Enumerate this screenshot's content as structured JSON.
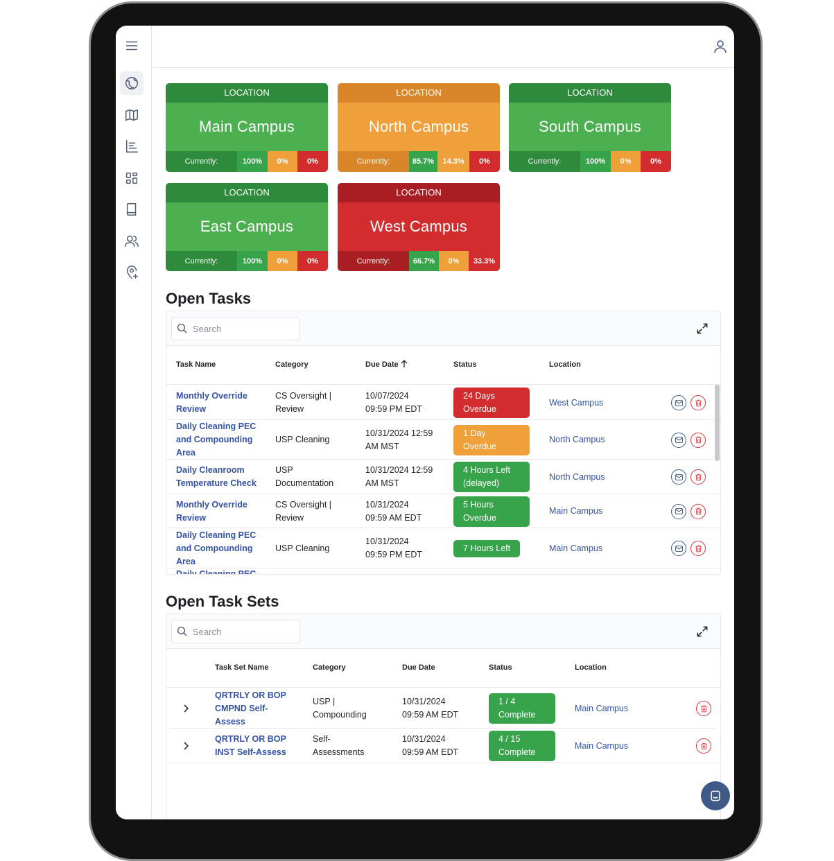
{
  "locations": [
    {
      "header": "LOCATION",
      "name": "Main Campus",
      "currently_label": "Currently:",
      "pct_green": "100%",
      "pct_orange": "0%",
      "pct_red": "0%",
      "status": "green"
    },
    {
      "header": "LOCATION",
      "name": "North Campus",
      "currently_label": "Currently:",
      "pct_green": "85.7%",
      "pct_orange": "14.3%",
      "pct_red": "0%",
      "status": "orange"
    },
    {
      "header": "LOCATION",
      "name": "South Campus",
      "currently_label": "Currently:",
      "pct_green": "100%",
      "pct_orange": "0%",
      "pct_red": "0%",
      "status": "green"
    },
    {
      "header": "LOCATION",
      "name": "East Campus",
      "currently_label": "Currently:",
      "pct_green": "100%",
      "pct_orange": "0%",
      "pct_red": "0%",
      "status": "green"
    },
    {
      "header": "LOCATION",
      "name": "West Campus",
      "currently_label": "Currently:",
      "pct_green": "66.7%",
      "pct_orange": "0%",
      "pct_red": "33.3%",
      "status": "red"
    }
  ],
  "open_tasks": {
    "title": "Open Tasks",
    "search_placeholder": "Search",
    "columns": {
      "name": "Task Name",
      "category": "Category",
      "due": "Due Date",
      "status": "Status",
      "location": "Location"
    },
    "rows": [
      {
        "name": [
          "Monthly Override",
          "Review"
        ],
        "category": [
          "CS Oversight |",
          "Review"
        ],
        "due": [
          "10/07/2024",
          "09:59 PM EDT"
        ],
        "status": [
          "24 Days",
          "Overdue"
        ],
        "status_color": "red",
        "location": "West Campus"
      },
      {
        "name": [
          "Daily Cleaning PEC",
          "and Compounding",
          "Area"
        ],
        "category": [
          "USP Cleaning"
        ],
        "due": [
          "10/31/2024 12:59",
          "AM MST"
        ],
        "status": [
          "1 Day",
          "Overdue"
        ],
        "status_color": "orange",
        "location": "North Campus"
      },
      {
        "name": [
          "Daily Cleanroom",
          "Temperature Check"
        ],
        "category": [
          "USP",
          "Documentation"
        ],
        "due": [
          "10/31/2024 12:59",
          "AM MST"
        ],
        "status": [
          "4 Hours Left",
          "(delayed)"
        ],
        "status_color": "green",
        "location": "North Campus"
      },
      {
        "name": [
          "Monthly Override",
          "Review"
        ],
        "category": [
          "CS Oversight |",
          "Review"
        ],
        "due": [
          "10/31/2024",
          "09:59 AM EDT"
        ],
        "status": [
          "5 Hours",
          "Overdue"
        ],
        "status_color": "green",
        "location": "Main Campus"
      },
      {
        "name": [
          "Daily Cleaning PEC",
          "and Compounding",
          "Area"
        ],
        "category": [
          "USP Cleaning"
        ],
        "due": [
          "10/31/2024",
          "09:59 PM EDT"
        ],
        "status": [
          "7 Hours Left"
        ],
        "status_color": "green",
        "location": "Main Campus"
      }
    ],
    "partial_row_text": "Daily Cleaning PEC"
  },
  "open_task_sets": {
    "title": "Open Task Sets",
    "search_placeholder": "Search",
    "columns": {
      "name": "Task Set Name",
      "category": "Category",
      "due": "Due Date",
      "status": "Status",
      "location": "Location"
    },
    "rows": [
      {
        "name": [
          "QRTRLY OR BOP",
          "CMPND Self-",
          "Assess"
        ],
        "category": [
          "USP |",
          "Compounding"
        ],
        "due": [
          "10/31/2024",
          "09:59 AM EDT"
        ],
        "status": [
          "1 / 4",
          "Complete"
        ],
        "location": "Main Campus"
      },
      {
        "name": [
          "QRTRLY OR BOP",
          "INST Self-Assess"
        ],
        "category": [
          "Self-",
          "Assessments"
        ],
        "due": [
          "10/31/2024",
          "09:59 AM EDT"
        ],
        "status": [
          "4 / 15",
          "Complete"
        ],
        "location": "Main Campus"
      }
    ]
  },
  "colors": {
    "green": "#4caf50",
    "orange": "#f0a03a",
    "red": "#d32c2f",
    "link": "#3452a8"
  },
  "icons": {
    "sidebar": [
      "menu-icon",
      "dashboard-globe-icon",
      "map-icon",
      "chart-icon",
      "widgets-icon",
      "book-icon",
      "users-icon",
      "add-location-icon"
    ],
    "topbar": "user-icon",
    "sort": "arrow-up-icon"
  }
}
